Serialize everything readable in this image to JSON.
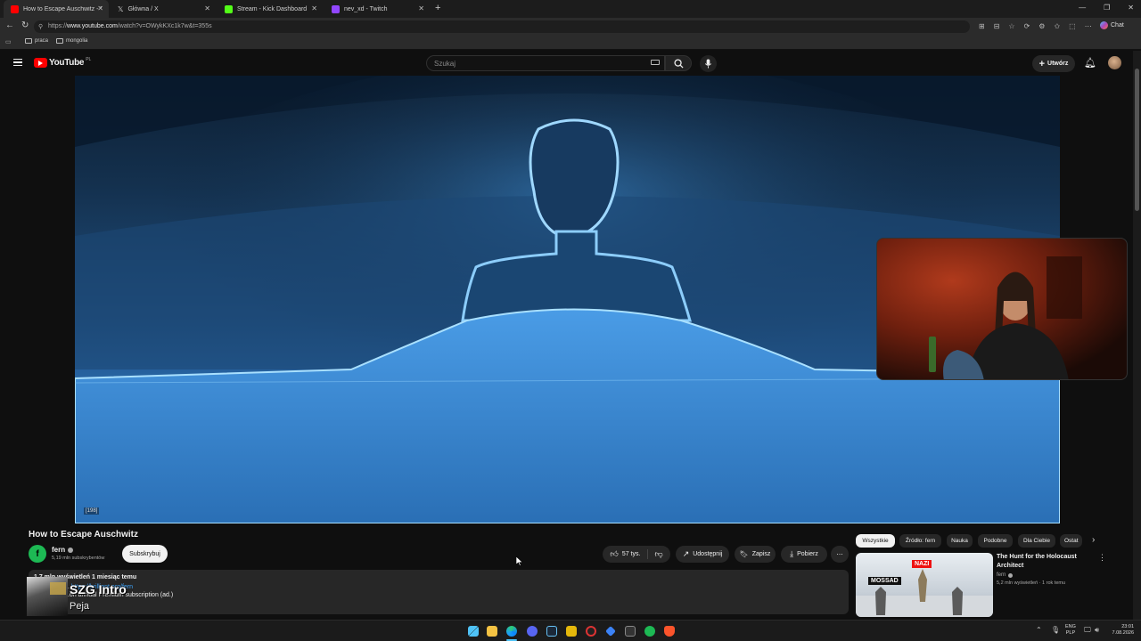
{
  "browser": {
    "tabs": [
      {
        "title": "How to Escape Auschwitz - Yo",
        "color": "#ff0000",
        "active": true
      },
      {
        "title": "Główna / X",
        "color": "#ffffff",
        "active": false
      },
      {
        "title": "Stream - Kick Dashboard",
        "color": "#53fc18",
        "active": false
      },
      {
        "title": "nev_xd - Twitch",
        "color": "#9146ff",
        "active": false
      }
    ],
    "new_tab": "+",
    "url_prefix": "https://",
    "url_host": "www.youtube.com",
    "url_path": "/watch?v=OWykKXc1k7w&t=355s",
    "bookmarks": [
      "praca",
      "mongolia"
    ],
    "chat_label": "Chat"
  },
  "youtube": {
    "logo_text": "YouTube",
    "logo_country": "PL",
    "search_placeholder": "Szukaj",
    "create_label": "Utwórz"
  },
  "video": {
    "corner_tag": "[198]",
    "title": "How to Escape Auschwitz"
  },
  "channel": {
    "name": "fern",
    "subscribers": "5,19 mln subskrybentów",
    "subscribe_label": "Subskrybuj"
  },
  "actions": {
    "likes": "57 tys.",
    "share": "Udostępnij",
    "save": "Zapisz",
    "download": "Pobierz"
  },
  "description": {
    "stats": "1,7 mln wyświetleń  1 miesiąc temu",
    "link_prefix": "...",
    "link": "https://brilliant.org/fern",
    "promo": "...on annual Premium subscription (ad.)"
  },
  "overlay": {
    "title": "SZG Intro",
    "artist": "Peja"
  },
  "chips": [
    "Wszystkie",
    "Źródło: fern",
    "Nauka",
    "Podobne",
    "Dla Ciebie",
    "Ostat"
  ],
  "recommended": [
    {
      "title": "The Hunt for the Holocaust Architect",
      "channel": "fern",
      "meta": "5,2 mln wyświetleń · 1 rok temu",
      "thumb_left_label": "MOSSAD",
      "thumb_right_label": "NAZI"
    }
  ],
  "taskbar": {
    "lang_top": "ENG",
    "lang_bottom": "PLP",
    "time": "23:01",
    "date": "7.08.2026"
  }
}
